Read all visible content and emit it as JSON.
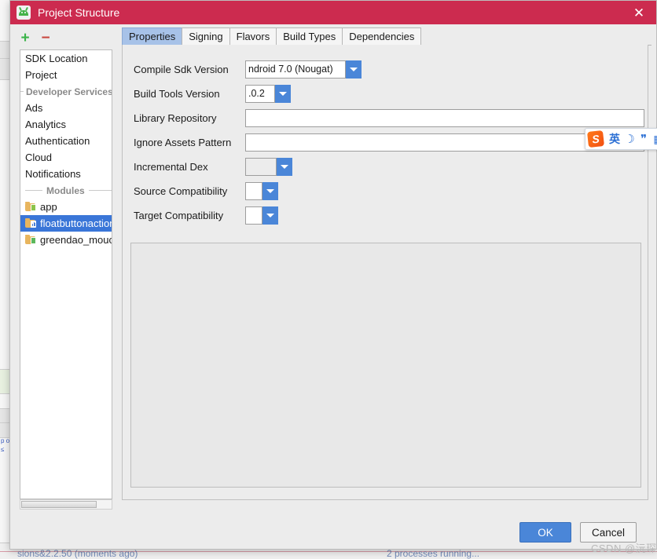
{
  "window": {
    "title": "Project Structure",
    "app_icon": "android-studio-icon",
    "close_icon": "✕",
    "titlebar_color": "#cc2b4f"
  },
  "left_panel": {
    "toolbar": {
      "add_label": "+",
      "remove_label": "−"
    },
    "items": [
      {
        "label": "SDK Location",
        "type": "item"
      },
      {
        "label": "Project",
        "type": "item"
      },
      {
        "label": "Developer Services",
        "type": "group"
      },
      {
        "label": "Ads",
        "type": "item"
      },
      {
        "label": "Analytics",
        "type": "item"
      },
      {
        "label": "Authentication",
        "type": "item"
      },
      {
        "label": "Cloud",
        "type": "item"
      },
      {
        "label": "Notifications",
        "type": "item"
      },
      {
        "label": "Modules",
        "type": "group"
      },
      {
        "label": "app",
        "type": "module",
        "icon": "android-module-icon"
      },
      {
        "label": "floatbuttonaction",
        "type": "module",
        "icon": "library-module-icon",
        "selected": true
      },
      {
        "label": "greendao_mouc",
        "type": "module",
        "icon": "library-module-icon"
      }
    ]
  },
  "tabs": [
    {
      "label": "Properties",
      "active": true
    },
    {
      "label": "Signing",
      "active": false
    },
    {
      "label": "Flavors",
      "active": false
    },
    {
      "label": "Build Types",
      "active": false
    },
    {
      "label": "Dependencies",
      "active": false
    }
  ],
  "properties": {
    "compile_sdk_version": {
      "label": "Compile Sdk Version",
      "value": "ndroid 7.0 (Nougat)"
    },
    "build_tools_version": {
      "label": "Build Tools Version",
      "value": ".0.2"
    },
    "library_repository": {
      "label": "Library Repository",
      "value": "",
      "placeholder": ""
    },
    "ignore_assets_pattern": {
      "label": "Ignore Assets Pattern",
      "value": "",
      "placeholder": ""
    },
    "incremental_dex": {
      "label": "Incremental Dex",
      "value": ""
    },
    "source_compatibility": {
      "label": "Source Compatibility",
      "value": ""
    },
    "target_compatibility": {
      "label": "Target Compatibility",
      "value": ""
    }
  },
  "footer": {
    "ok_label": "OK",
    "cancel_label": "Cancel"
  },
  "ime_toolbar": {
    "logo": "S",
    "language_label": "英",
    "moon_icon": "☽",
    "punctuation_icon": "❞",
    "keyboard_icon": "▦"
  },
  "background": {
    "status_left": "sions&2.2.50  (moments ago)",
    "status_right": "2 processes running...",
    "strip_glyphs": "p o ≤"
  },
  "watermark": "CSDN @沅琛"
}
